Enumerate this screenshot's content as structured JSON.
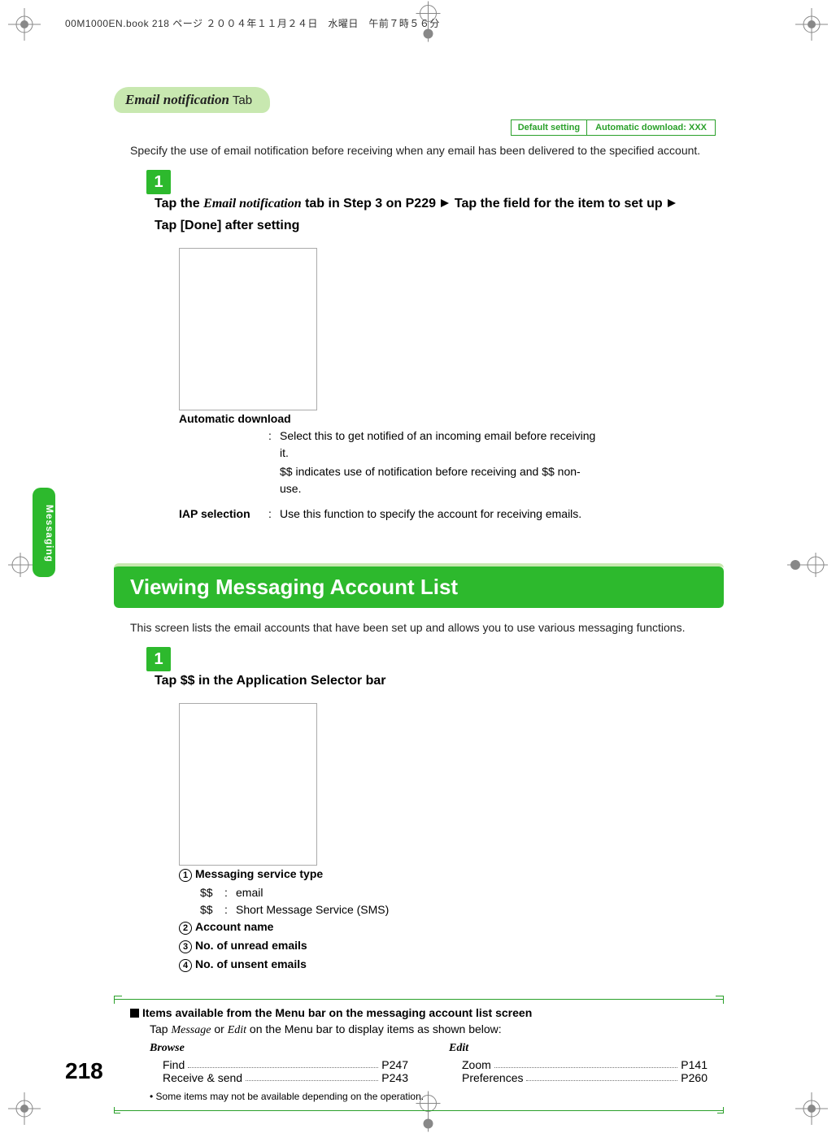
{
  "header_line": "00M1000EN.book  218 ページ  ２００４年１１月２４日　水曜日　午前７時５６分",
  "tab_title_italic": "Email notification",
  "tab_title_rest": " Tab",
  "default_badge": {
    "label": "Default setting",
    "value": "Automatic download: XXX"
  },
  "intro_text": "Specify the use of email notification before receiving when any email has been delivered to the specified account.",
  "step1": {
    "num": "1",
    "prefix": "Tap the ",
    "italic": "Email notification",
    "mid": " tab in Step 3 on P229 ",
    "after_arrow1": " Tap the field for the item to set up ",
    "after_arrow2": " Tap [Done] after setting"
  },
  "desc1": {
    "term1": "Automatic download",
    "def1a": "Select this to get notified of an incoming email before receiving it.",
    "def1b": "$$ indicates use of notification before receiving and $$ non-use.",
    "term2": "IAP selection",
    "def2": "Use this function to specify the account for receiving emails."
  },
  "side_tab": "Messaging",
  "section_banner": "Viewing Messaging Account List",
  "intro_text2": "This screen lists the email accounts that have been set up and allows you to use various messaging functions.",
  "step2": {
    "num": "1",
    "text": "Tap $$ in the Application Selector bar"
  },
  "desc2": {
    "item1": "Messaging service type",
    "sub1a_sym": "$$",
    "sub1a": "email",
    "sub1b_sym": "$$",
    "sub1b": "Short Message Service (SMS)",
    "item2": "Account name",
    "item3": "No. of unread emails",
    "item4": "No. of unsent emails"
  },
  "menu": {
    "heading": "Items available from the Menu bar on the messaging account list screen",
    "sub_pre": "Tap ",
    "sub_i1": "Message",
    "sub_mid": " or ",
    "sub_i2": "Edit",
    "sub_post": " on the Menu bar to display items as shown below:",
    "col1_h": "Browse",
    "col1_items": [
      {
        "name": "Find",
        "page": "P247"
      },
      {
        "name": "Receive & send",
        "page": "P243"
      }
    ],
    "col2_h": "Edit",
    "col2_items": [
      {
        "name": "Zoom",
        "page": "P141"
      },
      {
        "name": "Preferences",
        "page": "P260"
      }
    ],
    "note": "Some items may not be available depending on the operation."
  },
  "page_number": "218"
}
